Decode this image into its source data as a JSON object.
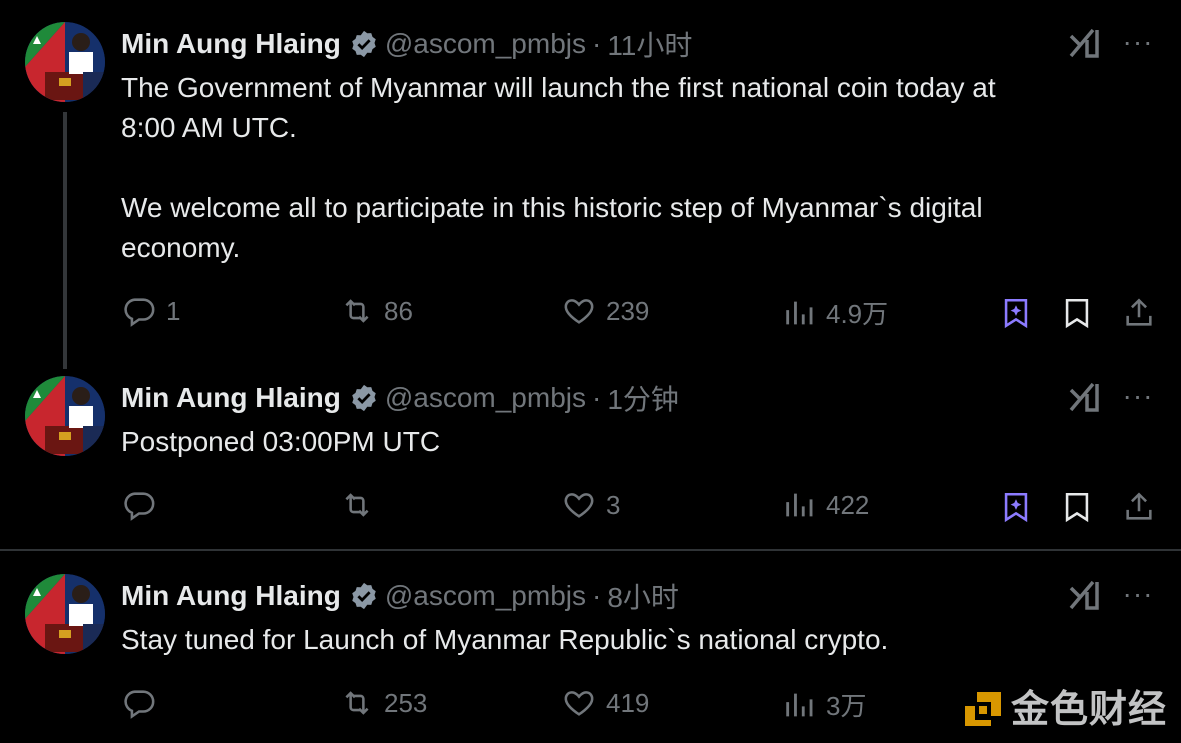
{
  "tweets": [
    {
      "name": "Min Aung Hlaing",
      "handle": "@ascom_pmbjs",
      "time": "11小时",
      "text": "The Government of Myanmar will launch the first national coin today at\n8:00 AM UTC.\n\nWe welcome all to participate in this historic step of Myanmar`s digital\neconomy.",
      "replies": "1",
      "reposts": "86",
      "likes": "239",
      "views": "4.9万"
    },
    {
      "name": "Min Aung Hlaing",
      "handle": "@ascom_pmbjs",
      "time": "1分钟",
      "text": "Postponed 03:00PM UTC",
      "replies": "",
      "reposts": "",
      "likes": "3",
      "views": "422"
    },
    {
      "name": "Min Aung Hlaing",
      "handle": "@ascom_pmbjs",
      "time": "8小时",
      "text": "Stay tuned for Launch of Myanmar Republic`s national crypto.",
      "replies": "",
      "reposts": "253",
      "likes": "419",
      "views": "3万"
    }
  ],
  "separator": "·",
  "more_glyph": "···",
  "watermark": {
    "text": "金色财经"
  },
  "colors": {
    "background": "#000000",
    "text": "#e7e9ea",
    "muted": "#71767b",
    "verified": "#8b98a5",
    "grok_purple": "#8c7bff",
    "watermark_gold": "#f0a800"
  }
}
